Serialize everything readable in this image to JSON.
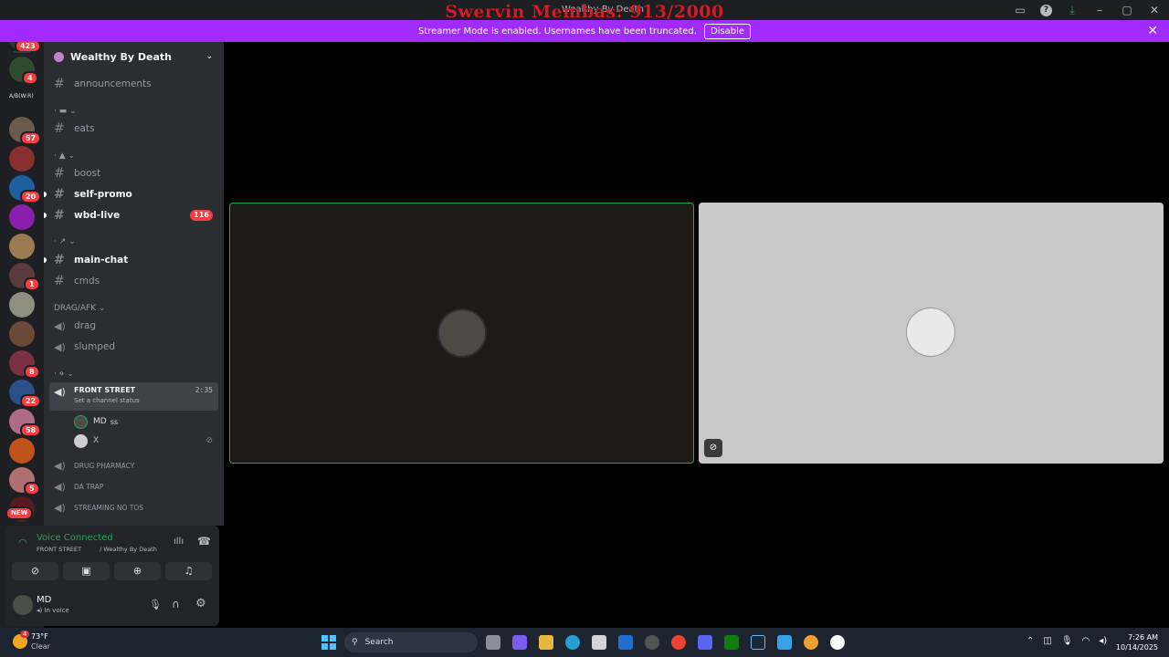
{
  "window": {
    "overlay_title": "Swervin Membas: 913/2000",
    "title": "Wealthy By Death"
  },
  "streamer": {
    "message": "Streamer Mode is enabled. Usernames have been truncated.",
    "button": "Disable"
  },
  "servers": {
    "home_badge": "423",
    "items": [
      {
        "badge": "4"
      },
      {
        "label": "A/B(W:R)"
      },
      {
        "badge": "57"
      },
      {
        "badge": ""
      },
      {
        "badge": "20"
      },
      {
        "badge": ""
      },
      {
        "badge": ""
      },
      {
        "badge": "1"
      },
      {
        "badge": ""
      },
      {
        "badge": ""
      },
      {
        "badge": "8"
      },
      {
        "badge": "22"
      },
      {
        "badge": "58"
      },
      {
        "badge": ""
      },
      {
        "badge": "5"
      },
      {
        "badge": "NEW"
      }
    ]
  },
  "guild": {
    "name": "Wealthy By Death"
  },
  "channels": {
    "announcements": "announcements",
    "eats": "eats",
    "boost": "boost",
    "self_promo": "self-promo",
    "wbd_live": "wbd-live",
    "wbd_live_badge": "116",
    "main_chat": "main-chat",
    "cmds": "cmds",
    "cat_drag": "DRAG/AFK",
    "drag": "drag",
    "slumped": "slumped",
    "front_street": "FRONT STREET",
    "front_street_time": "2:35",
    "front_street_status": "Set a channel status",
    "user_md": "MD",
    "user_md_suffix": "ss",
    "user_x": "X",
    "drug_pharmacy": "DRUG PHARMACY",
    "da_trap": "DA TRAP",
    "streaming_no_tos": "STREAMING NO TOS"
  },
  "voice": {
    "status": "Voice Connected",
    "location": "FRONT STREET",
    "location_guild": "/ Wealthy By Death"
  },
  "user": {
    "name": "MD",
    "state": "In voice"
  },
  "taskbar": {
    "temp": "73°F",
    "weather": "Clear",
    "weather_badge": "4",
    "search": "Search",
    "time": "7:26 AM",
    "date": "10/14/2025"
  },
  "colors": {
    "streamer_bar": "#a02bfb",
    "speaking_border": "#23a559",
    "unread_badge": "#f23f43"
  }
}
